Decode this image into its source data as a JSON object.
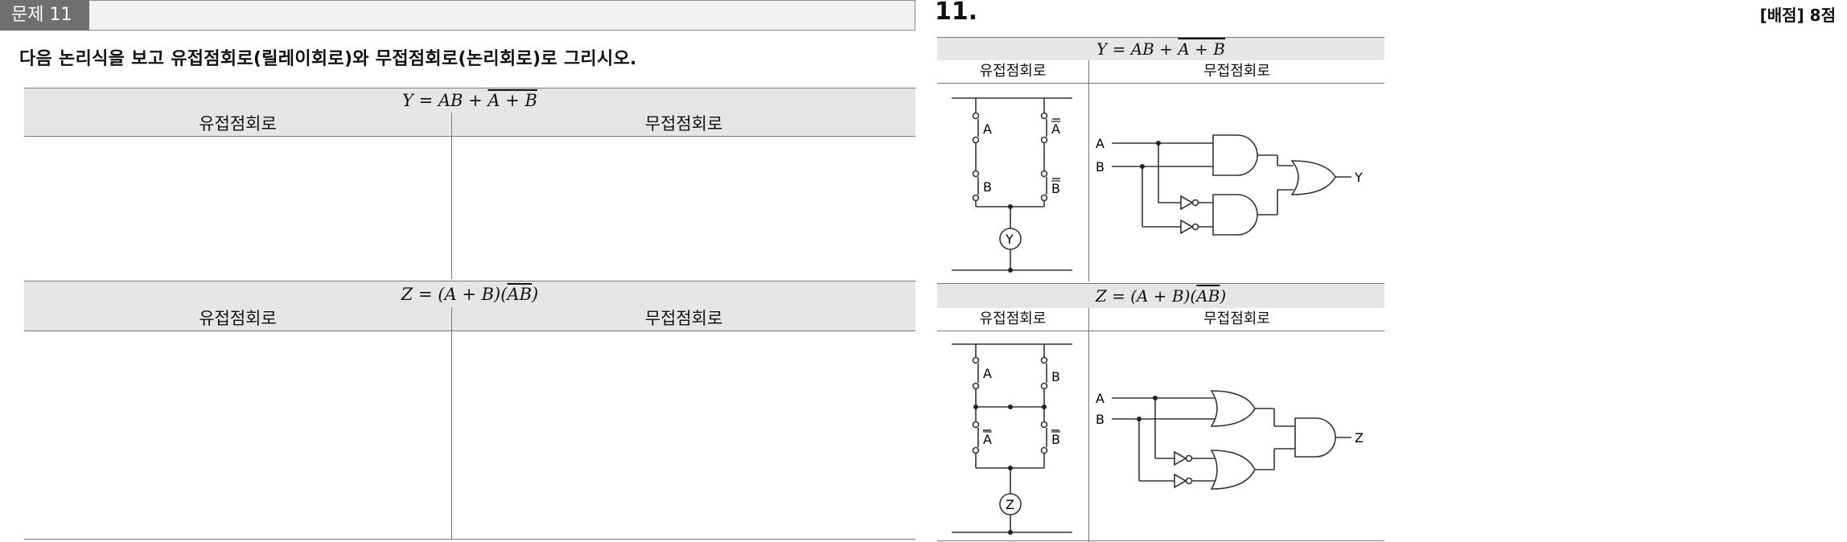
{
  "question": {
    "badge": "문제 11",
    "score": "[배점] 8점",
    "instruction": "다음 논리식을 보고 유접점회로(릴레이회로)와 무접점회로(논리회로)로 그리시오."
  },
  "answer": {
    "number": "11."
  },
  "tables": [
    {
      "eq_lhs": "Y = ",
      "eq_term1": "AB + ",
      "eq_over": "A + B",
      "col_relay": "유접점회로",
      "col_logic": "무접점회로"
    },
    {
      "eq_lhs": "Z = ",
      "eq_term1": "(A + B)(",
      "eq_over": "AB",
      "eq_close": ")",
      "col_relay": "유접점회로",
      "col_logic": "무접점회로"
    }
  ],
  "circuits": {
    "y_relay": {
      "c1": "A",
      "c2": "B",
      "c3": "A",
      "c4": "B",
      "coil": "Y"
    },
    "y_logic": {
      "in1": "A",
      "in2": "B",
      "out": "Y"
    },
    "z_relay": {
      "c1": "A",
      "c2": "B",
      "c3": "A",
      "c4": "B",
      "coil": "Z"
    },
    "z_logic": {
      "in1": "A",
      "in2": "B",
      "out": "Z"
    }
  }
}
